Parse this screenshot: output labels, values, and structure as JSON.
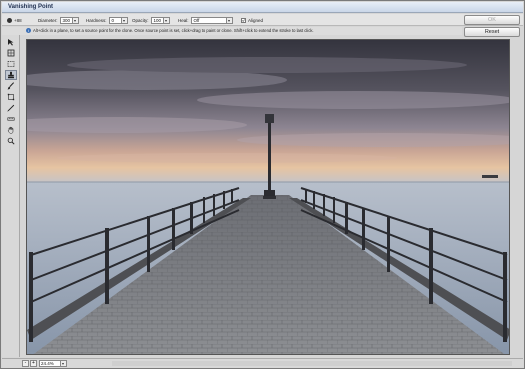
{
  "window": {
    "title": "Vanishing Point"
  },
  "options": {
    "diameter_label": "Diameter:",
    "diameter_value": "300",
    "hardness_label": "Hardness:",
    "hardness_value": "0",
    "opacity_label": "Opacity:",
    "opacity_value": "100",
    "heal_label": "Heal:",
    "heal_value": "Off",
    "aligned_label": "Aligned",
    "aligned_checked": true,
    "brush_icon_label": "+88"
  },
  "hint": {
    "text": "Alt+click in a plane, to set a source point for the clone. Once source point is set, click+drag to paint or clone. Shift+click to extend the stroke to last click."
  },
  "buttons": {
    "ok_label": "OK",
    "reset_label": "Reset"
  },
  "toolbar": {
    "tools": [
      "edit-plane",
      "create-plane",
      "marquee",
      "stamp",
      "brush",
      "transform",
      "eyedropper",
      "measure",
      "hand",
      "zoom"
    ],
    "selected": "stamp"
  },
  "status": {
    "zoom_minus": "-",
    "zoom_plus": "+",
    "zoom_value": "24.4%"
  },
  "colors": {
    "accent": "#3b6fb6",
    "canvas_sky_top": "#3f3f4a",
    "canvas_sea": "#9fb0c4"
  }
}
